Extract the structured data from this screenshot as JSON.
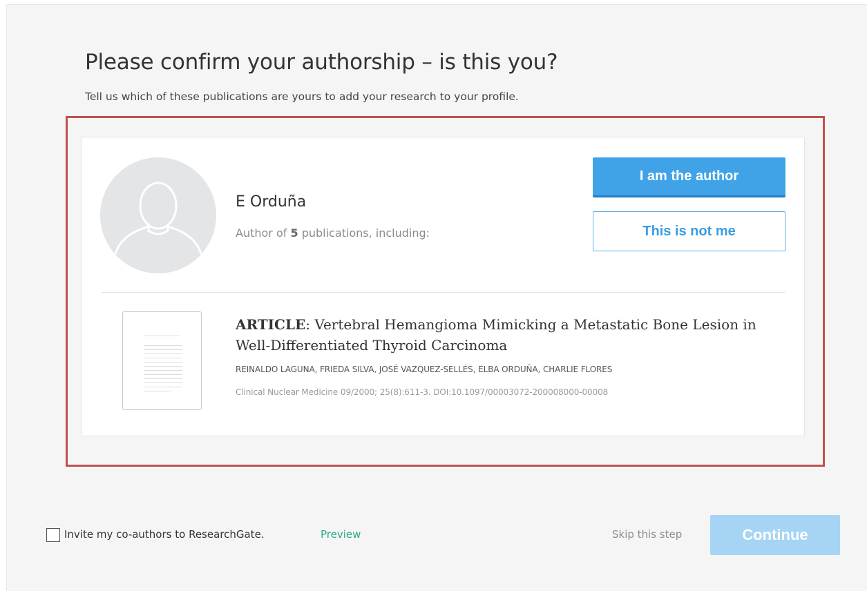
{
  "header": {
    "title": "Please confirm your authorship – is this you?",
    "subtitle": "Tell us which of these publications are yours to add your research to your profile."
  },
  "author": {
    "name": "E Orduña",
    "meta_prefix": "Author of ",
    "publication_count": "5",
    "meta_suffix": " publications, including:"
  },
  "actions": {
    "confirm_label": "I am the author",
    "reject_label": "This is not me"
  },
  "publication": {
    "type": "ARTICLE",
    "title": ": Vertebral Hemangioma Mimicking a Metastatic Bone Lesion in Well-Differentiated Thyroid Carcinoma",
    "authors": "REINALDO LAGUNA, FRIEDA SILVA, JOSÉ VAZQUEZ-SELLÉS, ELBA ORDUÑA, CHARLIE FLORES",
    "source": "Clinical Nuclear Medicine 09/2000; 25(8):611-3. DOI:10.1097/00003072-200008000-00008"
  },
  "footer": {
    "invite_label": "Invite my co-authors to ResearchGate.",
    "invite_checked": false,
    "preview_label": "Preview",
    "skip_label": "Skip this step",
    "continue_label": "Continue"
  },
  "colors": {
    "primary": "#40a3e8",
    "continue_disabled": "#a5d4f5",
    "link_green": "#2aa889",
    "highlight": "#c0504d"
  }
}
